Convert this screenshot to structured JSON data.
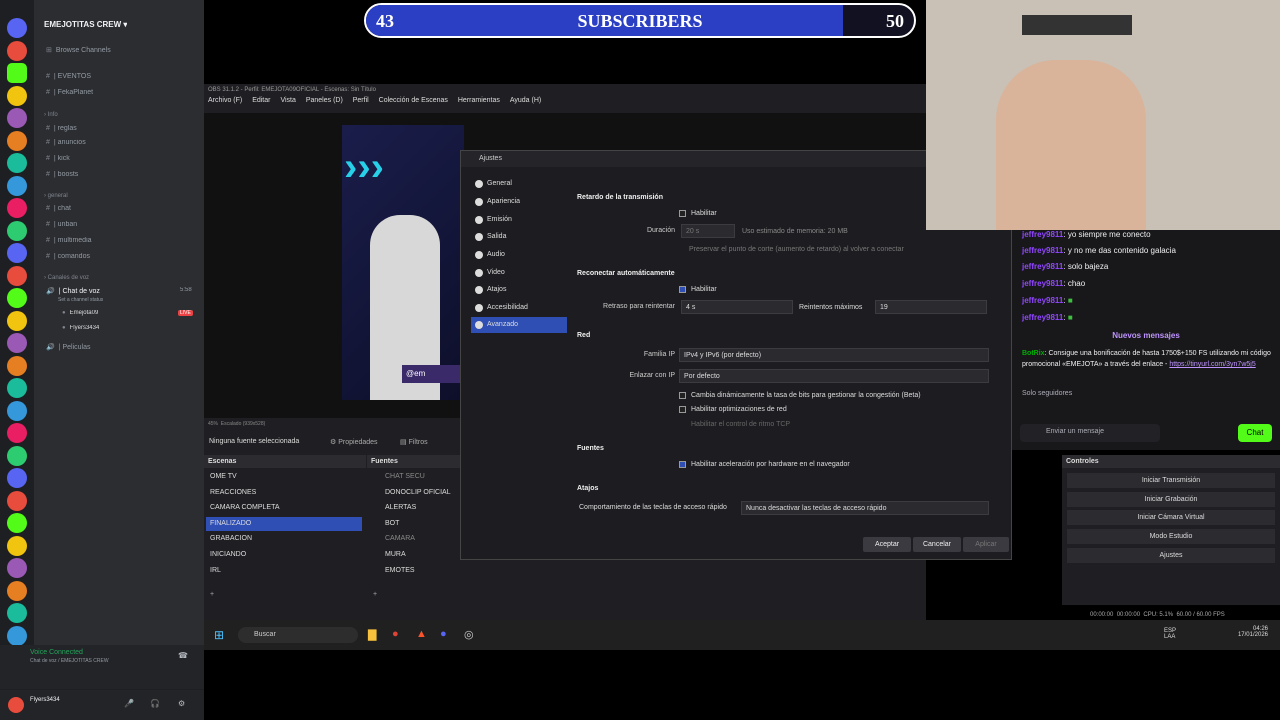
{
  "banner": {
    "left_count": "43",
    "title": "SUBSCRIBERS",
    "right_count": "50",
    "progress": 0.87
  },
  "discord": {
    "server_name": "EMEJOTITAS CREW",
    "browse": "Browse Channels",
    "channels_top": [
      "| EVENTOS",
      "| FekaPlanet"
    ],
    "cat_info": "Info",
    "info_channels": [
      "| reglas",
      "| anuncios",
      "| kick",
      "| boosts"
    ],
    "cat_general": "general",
    "general_channels": [
      "| chat",
      "| unban",
      "| multimedia",
      "| comandos"
    ],
    "cat_voice": "Canales de voz",
    "voice_channel": "| Chat de voz",
    "voice_status": "Set a channel status",
    "voice_time": "5:58",
    "voice_users": [
      "Emejota09",
      "Flyers3434"
    ],
    "live_badge": "LIVE",
    "movies": "| Peliculas",
    "voice_connected": "Voice Connected",
    "voice_connected_sub": "Chat de voz / EMEJOTITAS CREW",
    "user_name": "Flyers3434"
  },
  "obs": {
    "title": "OBS 31.1.2 - Perfil: EMEJOTA09OFICIAL - Escenas: Sin Título",
    "menu": [
      "Archivo (F)",
      "Editar",
      "Vista",
      "Paneles (D)",
      "Perfil",
      "Colección de Escenas",
      "Herramientas",
      "Ayuda (H)"
    ],
    "preview_tag": "@em",
    "zoom": "45%",
    "scale": "Escalado (939x528)",
    "no_source": "Ninguna fuente seleccionada",
    "properties": "Propiedades",
    "filters": "Filtros",
    "scenes_header": "Escenas",
    "scenes": [
      "OME TV",
      "REACCIONES",
      "CAMARA COMPLETA",
      "FINALIZADO",
      "GRABACION",
      "INICIANDO",
      "IRL"
    ],
    "selected_scene": 3,
    "sources_header": "Fuentes",
    "sources": [
      "CHAT SECU",
      "DONOCLIP OFICIAL",
      "ALERTAS",
      "BOT",
      "CAMARA",
      "MURA",
      "EMOTES"
    ],
    "controls_header": "Controles",
    "controls": [
      "Iniciar Transmisión",
      "Iniciar Grabación",
      "Iniciar Cámara Virtual",
      "Modo Estudio",
      "Ajustes"
    ],
    "status": {
      "time1": "00:00:00",
      "time2": "00:00:00",
      "cpu": "CPU: 5.1%",
      "fps": "60.00 / 60.00 FPS"
    }
  },
  "settings": {
    "title": "Ajustes",
    "nav": [
      "General",
      "Apariencia",
      "Emisión",
      "Salida",
      "Audio",
      "Video",
      "Atajos",
      "Accesibilidad",
      "Avanzado"
    ],
    "selected_nav": 8,
    "retardo_header": "Retardo de la transmisión",
    "habilitar": "Habilitar",
    "duracion_label": "Duración",
    "duracion_value": "20 s",
    "memoria": "Uso estimado de memoria: 20 MB",
    "preservar": "Preservar el punto de corte (aumento de retardo) al volver a conectar",
    "reconectar_header": "Reconectar automáticamente",
    "retraso_label": "Retraso para reintentar",
    "retraso_value": "4 s",
    "reintentos_label": "Reintentos máximos",
    "reintentos_value": "19",
    "red_header": "Red",
    "familia_label": "Familia IP",
    "familia_value": "IPv4 y IPv6 (por defecto)",
    "enlazar_label": "Enlazar con IP",
    "enlazar_value": "Por defecto",
    "cambia": "Cambia dinámicamente la tasa de bits para gestionar la congestión (Beta)",
    "optimizaciones": "Habilitar optimizaciones de red",
    "tcp": "Habilitar el control de ritmo TCP",
    "fuentes_header": "Fuentes",
    "aceleracion": "Habilitar aceleración por hardware en el navegador",
    "atajos_header": "Atajos",
    "comportamiento_label": "Comportamiento de las teclas de acceso rápido",
    "comportamiento_value": "Nunca desactivar las teclas de acceso rápido",
    "aceptar": "Aceptar",
    "cancelar": "Cancelar",
    "aplicar": "Aplicar"
  },
  "chat": {
    "messages": [
      {
        "user": "jeffrey9811",
        "text": "yo siempre me conecto"
      },
      {
        "user": "jeffrey9811",
        "text": "y no me das contenido galacia"
      },
      {
        "user": "jeffrey9811",
        "text": "solo bajeza"
      },
      {
        "user": "jeffrey9811",
        "text": "chao"
      },
      {
        "user": "jeffrey9811",
        "text": ""
      },
      {
        "user": "jeffrey9811",
        "text": ""
      }
    ],
    "new_messages": "Nuevos mensajes",
    "bot_user": "BotRix",
    "bot_text": "Consigue una bonificación de hasta 1750$+150 FS utilizando mi código promocional «EMEJOTA» a través del enlace -",
    "bot_link": "https://tinyurl.com/3yn7w5j5",
    "followers_only": "Solo seguidores",
    "input_placeholder": "Enviar un mensaje",
    "chat_button": "Chat"
  },
  "taskbar": {
    "search": "Buscar",
    "lang": "ESP LAA",
    "time": "04:26",
    "date": "17/01/2026"
  }
}
